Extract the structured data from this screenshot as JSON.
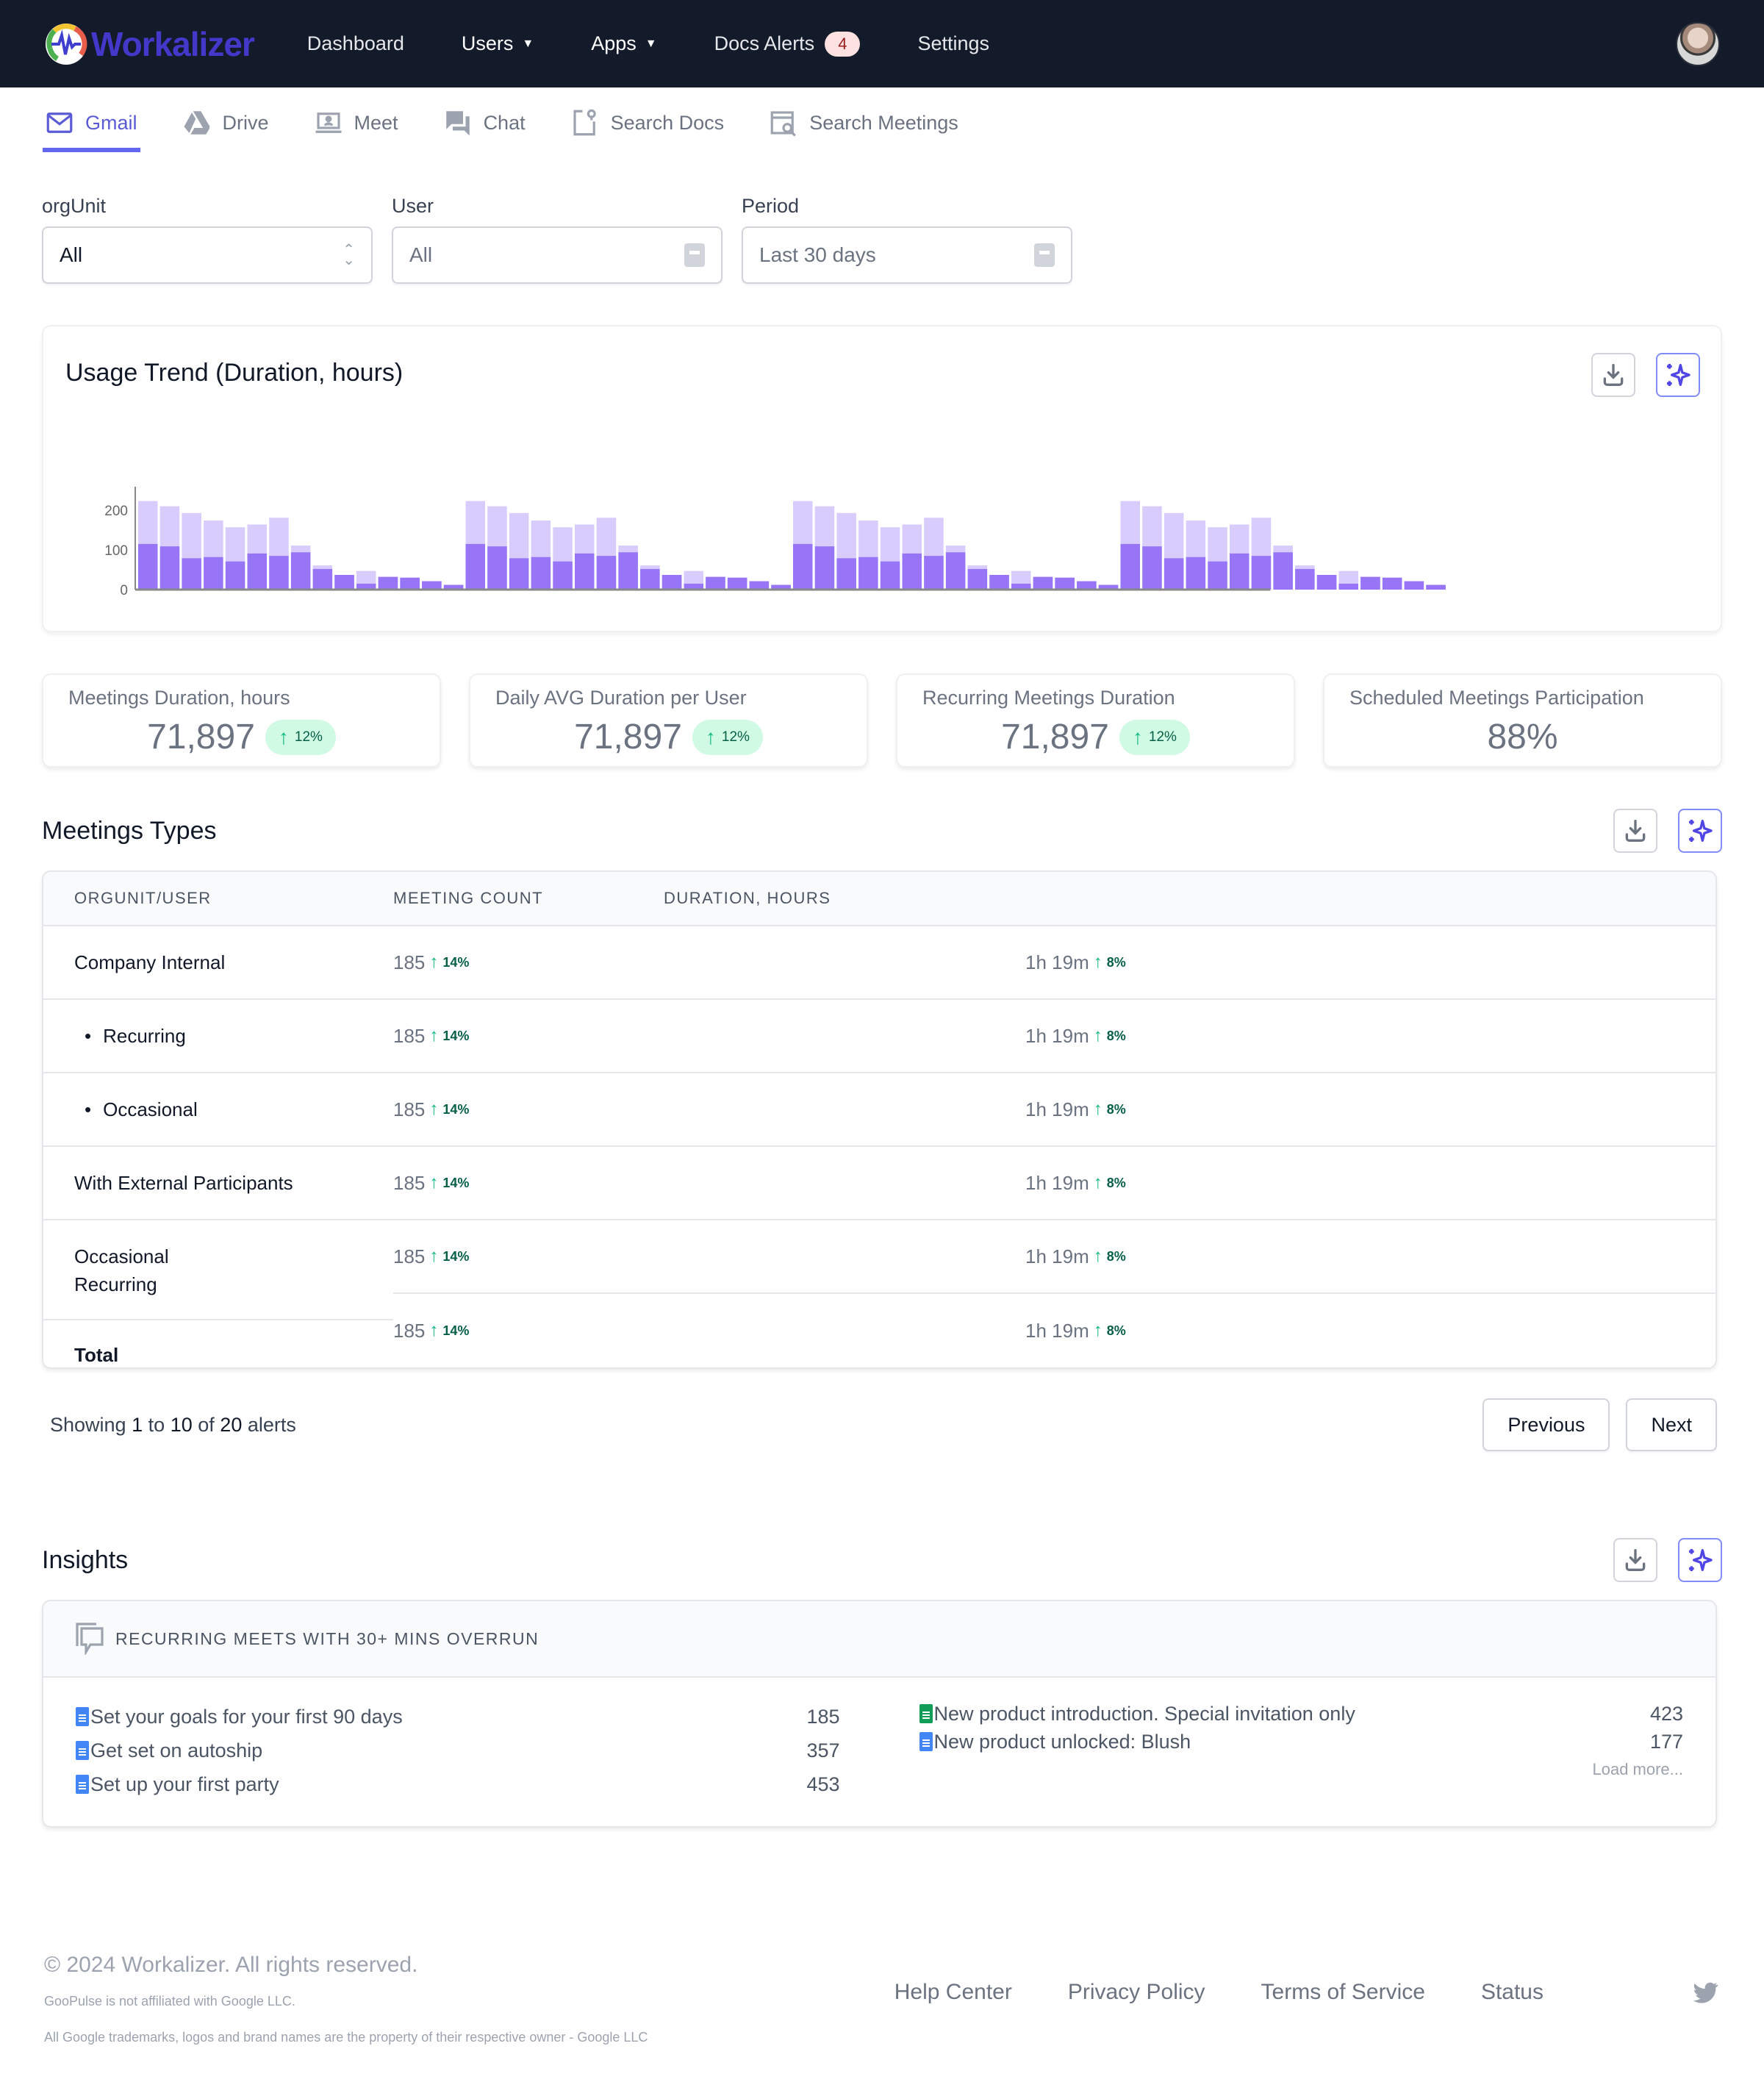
{
  "nav": {
    "brand": "Workalizer",
    "items": [
      {
        "label": "Dashboard",
        "dropdown": false
      },
      {
        "label": "Users",
        "dropdown": true
      },
      {
        "label": "Apps",
        "dropdown": true
      },
      {
        "label": "Docs Alerts",
        "dropdown": false,
        "badge": "4"
      },
      {
        "label": "Settings",
        "dropdown": false
      }
    ]
  },
  "subtabs": [
    {
      "label": "Gmail",
      "icon": "mail-icon",
      "active": true
    },
    {
      "label": "Drive",
      "icon": "drive-icon",
      "active": false
    },
    {
      "label": "Meet",
      "icon": "meet-icon",
      "active": false
    },
    {
      "label": "Chat",
      "icon": "chat-icon",
      "active": false
    },
    {
      "label": "Search Docs",
      "icon": "search-docs-icon",
      "active": false
    },
    {
      "label": "Search Meetings",
      "icon": "search-meetings-icon",
      "active": false
    }
  ],
  "filters": {
    "orgunit": {
      "label": "orgUnit",
      "value": "All"
    },
    "user": {
      "label": "User",
      "value": "All"
    },
    "period": {
      "label": "Period",
      "value": "Last 30 days"
    }
  },
  "usage": {
    "title": "Usage Trend (Duration, hours)"
  },
  "chart_data": {
    "type": "bar",
    "stacked": false,
    "title": "Usage Trend (Duration, hours)",
    "xlabel": "",
    "ylabel": "",
    "ylim": [
      0,
      230
    ],
    "yticks": [
      "0",
      "100",
      "200"
    ],
    "grid": false,
    "colors": {
      "total": "#d8ccfd",
      "part": "#9775f6"
    },
    "series": [
      {
        "name": "total",
        "values": [
          223,
          210,
          193,
          174,
          157,
          164,
          181,
          111,
          61,
          37,
          47,
          32,
          30,
          21,
          12,
          223,
          210,
          193,
          174,
          157,
          164,
          181,
          111,
          61,
          37,
          47,
          32,
          30,
          21,
          12,
          223,
          210,
          193,
          174,
          157,
          164,
          181,
          111,
          61,
          37,
          47,
          32,
          30,
          21,
          12,
          223,
          210,
          193,
          174,
          157,
          164,
          181,
          111,
          61,
          37,
          47,
          32,
          30,
          21,
          12
        ]
      },
      {
        "name": "part",
        "values": [
          115,
          109,
          79,
          82,
          71,
          91,
          85,
          94,
          52,
          37,
          15,
          32,
          30,
          21,
          12,
          115,
          109,
          79,
          82,
          71,
          91,
          85,
          94,
          52,
          37,
          15,
          32,
          30,
          21,
          12,
          115,
          109,
          79,
          82,
          71,
          91,
          85,
          94,
          52,
          37,
          15,
          32,
          30,
          21,
          12,
          115,
          109,
          79,
          82,
          71,
          91,
          85,
          94,
          52,
          37,
          15,
          32,
          30,
          21,
          12
        ]
      }
    ]
  },
  "kpis": [
    {
      "label": "Meetings Duration, hours",
      "value": "71,897",
      "delta": "12%"
    },
    {
      "label": "Daily AVG Duration per User",
      "value": "71,897",
      "delta": "12%"
    },
    {
      "label": "Recurring Meetings Duration",
      "value": "71,897",
      "delta": "12%"
    },
    {
      "label": "Scheduled Meetings Participation",
      "value": "88%",
      "delta": null
    }
  ],
  "meetings": {
    "title": "Meetings Types",
    "columns": [
      "ORGUNIT/USER",
      "MEETING COUNT",
      "DURATION, HOURS"
    ],
    "rows": [
      {
        "name": "Company Internal",
        "count": "185",
        "count_delta": "14%",
        "duration": "1h 19m",
        "duration_delta": "8%"
      },
      {
        "name": "Recurring",
        "count": "185",
        "count_delta": "14%",
        "duration": "1h 19m",
        "duration_delta": "8%"
      },
      {
        "name": "Occasional",
        "count": "185",
        "count_delta": "14%",
        "duration": "1h 19m",
        "duration_delta": "8%"
      },
      {
        "name": "With External Participants",
        "count": "185",
        "count_delta": "14%",
        "duration": "1h 19m",
        "duration_delta": "8%"
      },
      {
        "name": "Occasional\nRecurring",
        "name_lines": [
          "Occasional",
          "Recurring"
        ],
        "count": "185",
        "count_delta": "14%",
        "duration": "1h 19m",
        "duration_delta": "8%"
      },
      {
        "name": "Total",
        "count": "185",
        "count_delta": "14%",
        "duration": "1h 19m",
        "duration_delta": "8%"
      }
    ]
  },
  "pagination": {
    "prefix": "Showing",
    "from": "1",
    "to_word": "to",
    "to": "10",
    "of_word": "of",
    "total": "20",
    "suffix": "alerts",
    "previous": "Previous",
    "next": "Next"
  },
  "insights": {
    "title": "Insights",
    "header": "RECURRING MEETS WITH 30+ MINS OVERRUN",
    "left": [
      {
        "name": "Set your goals for your first 90 days",
        "value": "185",
        "type": "docs"
      },
      {
        "name": "Get set on autoship",
        "value": "357",
        "type": "docs"
      },
      {
        "name": "Set up your first party",
        "value": "453",
        "type": "docs"
      }
    ],
    "right": [
      {
        "name": "New product introduction. Special invitation only",
        "value": "423",
        "type": "sheets"
      },
      {
        "name": "New product unlocked: Blush",
        "value": "177",
        "type": "docs"
      }
    ],
    "load_more": "Load more..."
  },
  "footer": {
    "copyright": "© 2024 Workalizer. All rights reserved.",
    "disclaimer1": "GooPulse is not affiliated with Google LLC.",
    "disclaimer2": "All Google trademarks, logos and brand names are the property of their respective owner - Google LLC",
    "links": [
      "Help Center",
      "Privacy Policy",
      "Terms of Service",
      "Status"
    ]
  }
}
